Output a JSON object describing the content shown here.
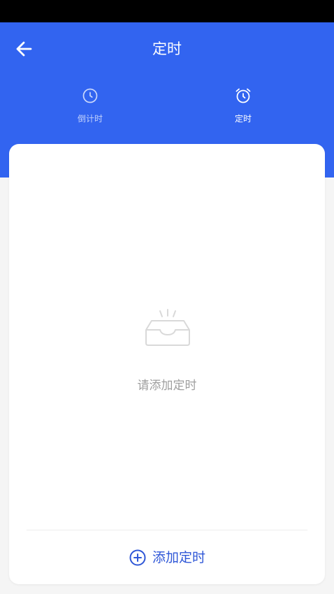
{
  "header": {
    "title": "定时",
    "tabs": [
      {
        "label": "倒计时",
        "icon": "clock-icon",
        "selected": false
      },
      {
        "label": "定时",
        "icon": "alarm-clock-icon",
        "selected": true
      }
    ]
  },
  "empty_state": {
    "icon": "empty-tray-icon",
    "text": "请添加定时"
  },
  "footer": {
    "add_label": "添加定时",
    "add_icon": "add-circle-icon"
  },
  "colors": {
    "header_bg": "#3264f0",
    "accent": "#2f57d7",
    "page_bg": "#f5f5f5"
  }
}
